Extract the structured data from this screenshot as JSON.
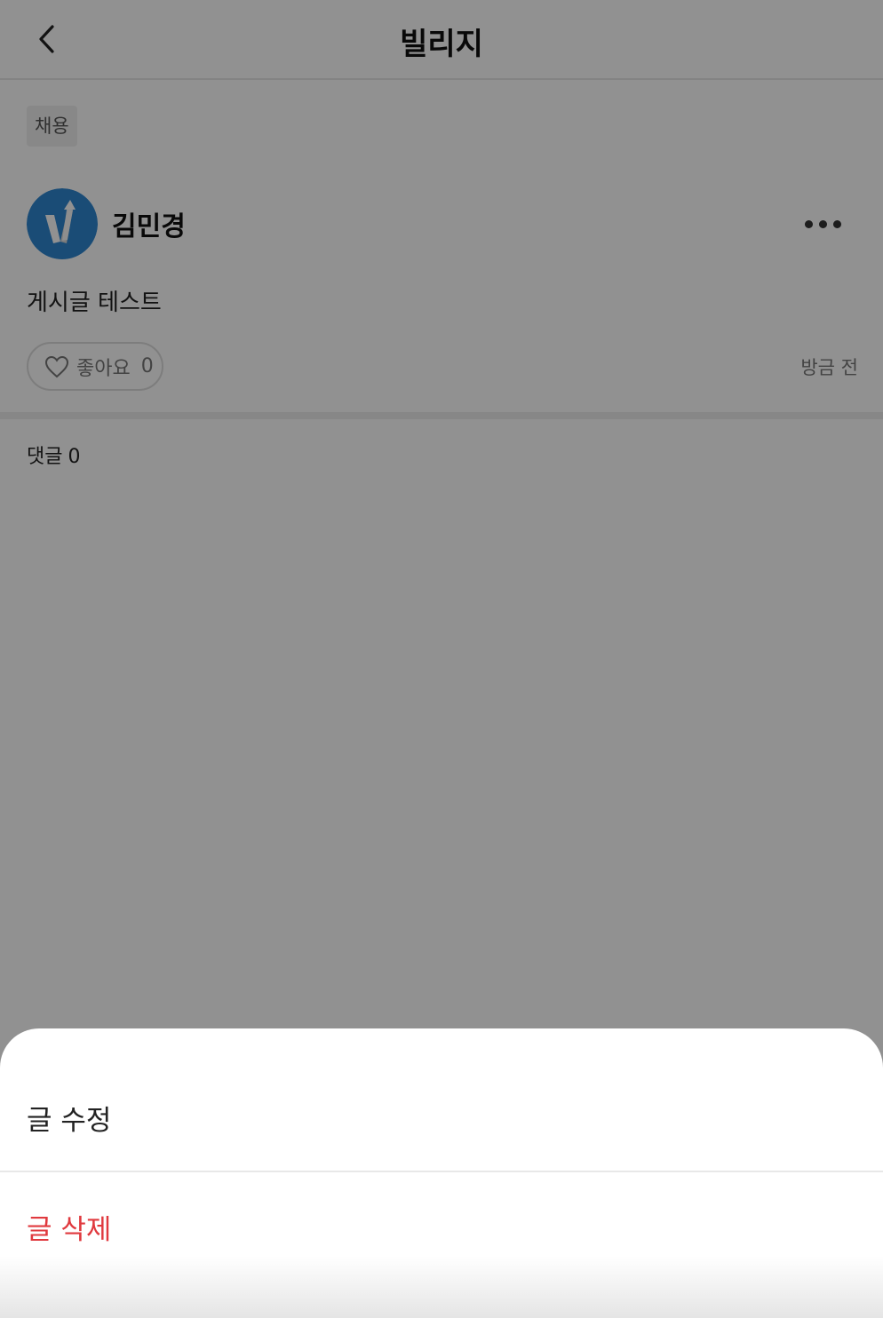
{
  "header": {
    "title": "빌리지",
    "back_icon": "chevron-left-icon"
  },
  "post": {
    "category": "채용",
    "author": {
      "name": "김민경",
      "avatar_icon": "v-logo-avatar"
    },
    "more_icon": "more-horizontal-icon",
    "body": "게시글 테스트",
    "like": {
      "icon": "heart-outline-icon",
      "label": "좋아요",
      "count": "0"
    },
    "timestamp": "방금 전"
  },
  "comments": {
    "label": "댓글",
    "count": "0"
  },
  "action_sheet": {
    "edit_label": "글 수정",
    "delete_label": "글 삭제",
    "delete_color": "#e0393e"
  },
  "colors": {
    "avatar_bg": "#2f86d0",
    "overlay": "rgba(0,0,0,0.43)"
  }
}
